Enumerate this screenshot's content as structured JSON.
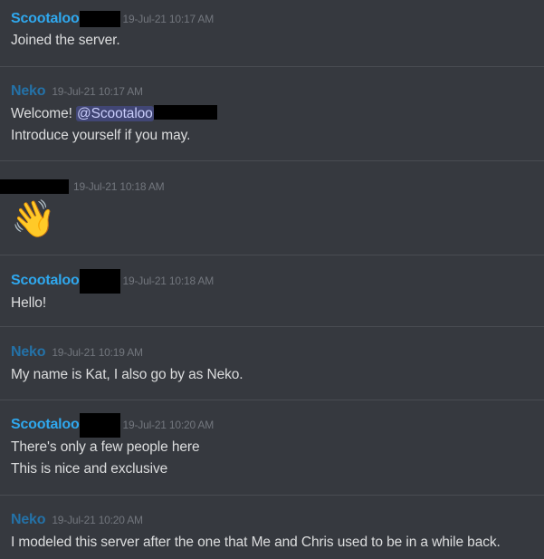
{
  "messages": [
    {
      "author": "Scootaloo",
      "timestamp": "19-Jul-21 10:17 AM",
      "lines": [
        "Joined the server."
      ]
    },
    {
      "author": "Neko",
      "timestamp": "19-Jul-21 10:17 AM",
      "line1_before": "Welcome! ",
      "mention": "@Scootaloo",
      "line2": "Introduce yourself if you may."
    },
    {
      "author": "",
      "timestamp": "19-Jul-21 10:18 AM",
      "emoji": "👋",
      "emoji_name": "waving-hand"
    },
    {
      "author": "Scootaloo",
      "timestamp": "19-Jul-21 10:18 AM",
      "lines": [
        "Hello!"
      ]
    },
    {
      "author": "Neko",
      "timestamp": "19-Jul-21 10:19 AM",
      "lines": [
        "My name is Kat, I also go by as Neko."
      ]
    },
    {
      "author": "Scootaloo",
      "timestamp": "19-Jul-21 10:20 AM",
      "lines": [
        "There's only a few people here",
        "This is nice and exclusive"
      ]
    },
    {
      "author": "Neko",
      "timestamp": "19-Jul-21 10:20 AM",
      "lines": [
        "I modeled this server after the one that Me and Chris used to be in a while back."
      ]
    }
  ],
  "colors": {
    "background": "#36393f",
    "scootaloo_name": "#2fa8ee",
    "neko_name": "#2472a8",
    "timestamp": "#72767d",
    "text": "#dcddde",
    "mention_bg": "#414675",
    "mention_text": "#c9cdfb"
  }
}
